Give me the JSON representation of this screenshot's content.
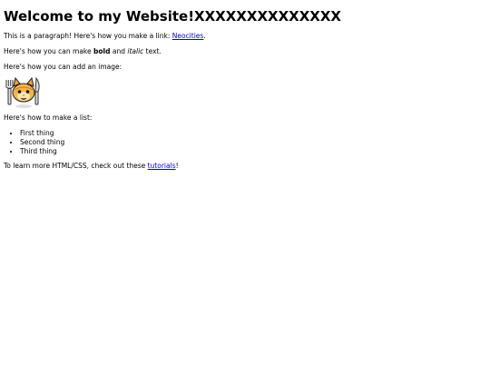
{
  "heading": "Welcome to my Website!XXXXXXXXXXXXXX",
  "p1": {
    "text": "This is a paragraph! Here's how you make a link: ",
    "link": "Neocities",
    "after": "."
  },
  "p2": {
    "text": "Here's how you can make ",
    "bold": "bold",
    "mid": " and ",
    "italic": "italic",
    "after": " text."
  },
  "p3": {
    "text": "Here's how you can add an image:"
  },
  "p4": {
    "text": "Here's how to make a list:"
  },
  "list": [
    "First thing",
    "Second thing",
    "Third thing"
  ],
  "p5": {
    "text": "To learn more HTML/CSS, check out these ",
    "link": "tutorials",
    "after": "!"
  },
  "image": {
    "icon": "cat-mascot-icon"
  }
}
